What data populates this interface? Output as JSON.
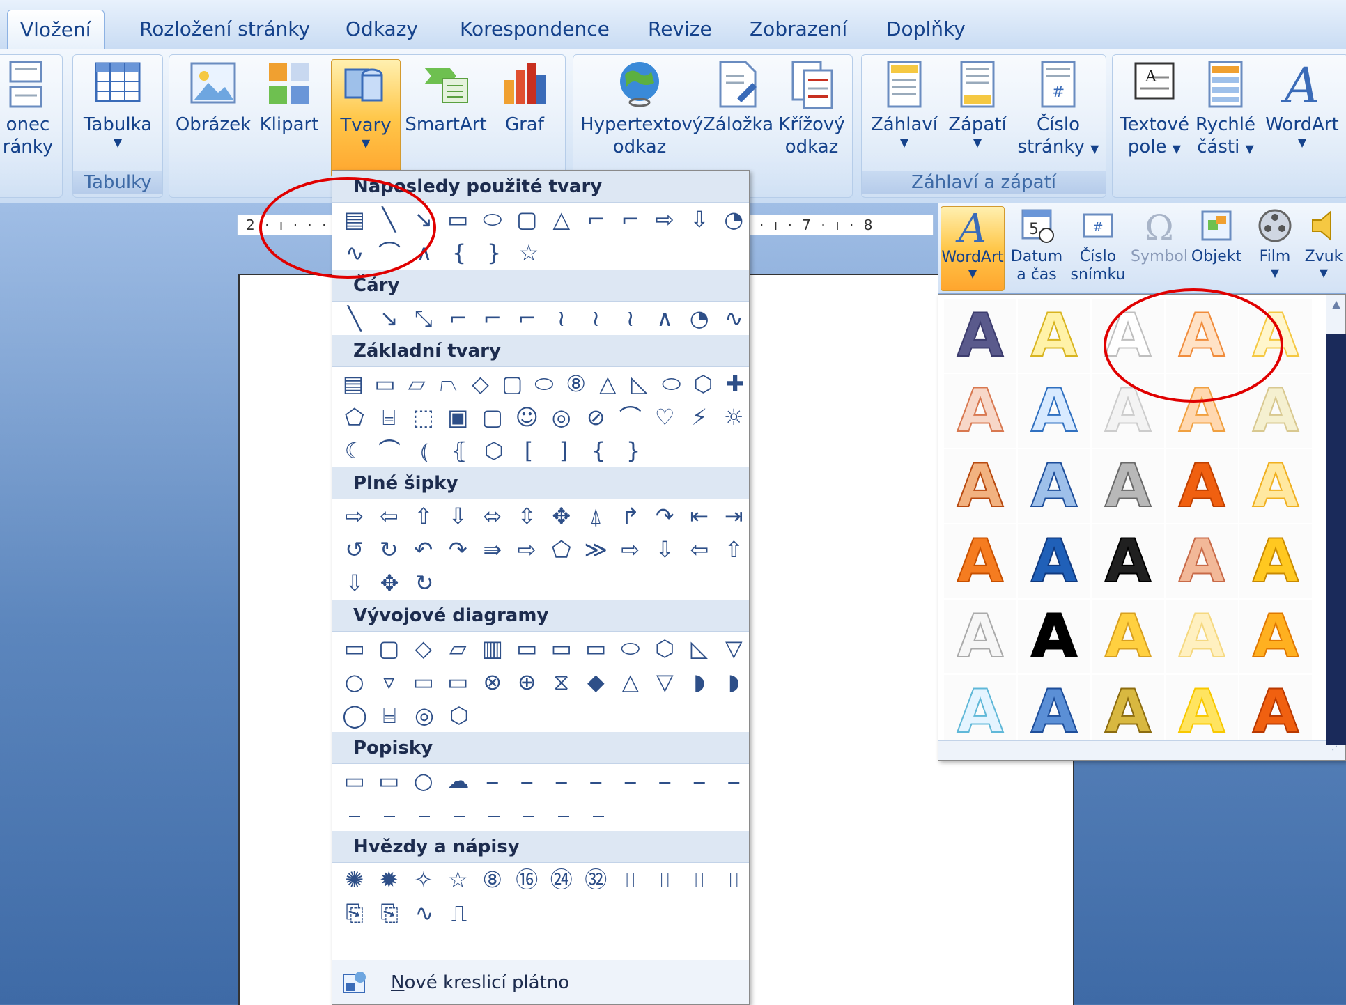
{
  "tabs": [
    {
      "label": "Vložení",
      "active": true
    },
    {
      "label": "Rozložení stránky"
    },
    {
      "label": "Odkazy"
    },
    {
      "label": "Korespondence"
    },
    {
      "label": "Revize"
    },
    {
      "label": "Zobrazení"
    },
    {
      "label": "Doplňky"
    }
  ],
  "ribbon": {
    "pagebreak": {
      "line1": "onec",
      "line2": "ránky"
    },
    "table": {
      "label": "Tabulka",
      "group": "Tabulky"
    },
    "illustrations": {
      "picture": "Obrázek",
      "clipart": "Klipart",
      "shapes": "Tvary",
      "smartart": "SmartArt",
      "chart": "Graf"
    },
    "links": {
      "hyperlink_line1": "Hypertextový",
      "hyperlink_line2": "odkaz",
      "bookmark": "Záložka",
      "crossref_line1": "Křížový",
      "crossref_line2": "odkaz"
    },
    "headerfooter": {
      "header": "Záhlaví",
      "footer": "Zápatí",
      "pagenum_line1": "Číslo",
      "pagenum_line2": "stránky",
      "group": "Záhlaví a zápatí"
    },
    "text": {
      "textbox_line1": "Textové",
      "textbox_line2": "pole",
      "quickparts_line1": "Rychlé",
      "quickparts_line2": "části",
      "wordart": "WordArt"
    }
  },
  "ruler": {
    "text": "2 · ı · · · · · · · · · · · · · · · · · · · · · · · · · · · · · · · 6 · ı · 7 · ı · 8"
  },
  "shapes_menu": {
    "sections": [
      {
        "title": "Naposledy použité tvary",
        "rows": [
          [
            "▤",
            "╲",
            "↘",
            "▭",
            "⬭",
            "▢",
            "△",
            "⌐",
            "⌐",
            "⇨",
            "⇩",
            "◔"
          ],
          [
            "∿",
            "⌒",
            "∧",
            "{",
            "}",
            "☆"
          ]
        ]
      },
      {
        "title": "Čáry",
        "rows": [
          [
            "╲",
            "↘",
            "⤡",
            "⌐",
            "⌐",
            "⌐",
            "≀",
            "≀",
            "≀",
            "∧",
            "◔",
            "∿"
          ]
        ]
      },
      {
        "title": "Základní tvary",
        "rows": [
          [
            "▤",
            "▭",
            "▱",
            "⏢",
            "◇",
            "▢",
            "⬭",
            "⑧",
            "△",
            "◺",
            "⬭",
            "⬡",
            "✚"
          ],
          [
            "⬠",
            "⌸",
            "⬚",
            "▣",
            "▢",
            "☺",
            "◎",
            "⊘",
            "⌒",
            "♡",
            "⚡",
            "☼"
          ],
          [
            "☾",
            "⌒",
            "⦅",
            "⦃",
            "⬡",
            "[",
            "]",
            "{",
            "}"
          ]
        ]
      },
      {
        "title": "Plné šipky",
        "rows": [
          [
            "⇨",
            "⇦",
            "⇧",
            "⇩",
            "⬄",
            "⇳",
            "✥",
            "⍋",
            "↱",
            "↷",
            "⇤",
            "⇥"
          ],
          [
            "↺",
            "↻",
            "↶",
            "↷",
            "⇛",
            "⇨",
            "⬠",
            "≫",
            "⇨",
            "⇩",
            "⇦",
            "⇧"
          ],
          [
            "⇩",
            "✥",
            "↻"
          ]
        ]
      },
      {
        "title": "Vývojové diagramy",
        "rows": [
          [
            "▭",
            "▢",
            "◇",
            "▱",
            "▥",
            "▭",
            "▭",
            "▭",
            "⬭",
            "⬡",
            "◺",
            "▽"
          ],
          [
            "○",
            "▿",
            "▭",
            "▭",
            "⊗",
            "⊕",
            "⧖",
            "◆",
            "△",
            "▽",
            "◗",
            "◗"
          ],
          [
            "◯",
            "⌸",
            "◎",
            "⬡"
          ]
        ]
      },
      {
        "title": "Popisky",
        "rows": [
          [
            "▭",
            "▭",
            "○",
            "☁",
            "⎯",
            "⎯",
            "⎯",
            "⎯",
            "⎯",
            "⎯",
            "⎯",
            "⎯"
          ],
          [
            "⎯",
            "⎯",
            "⎯",
            "⎯",
            "⎯",
            "⎯",
            "⎯",
            "⎯"
          ]
        ]
      },
      {
        "title": "Hvězdy a nápisy",
        "rows": [
          [
            "✺",
            "✹",
            "✧",
            "☆",
            "⑧",
            "⑯",
            "㉔",
            "㉜",
            "⎍",
            "⎍",
            "⎍",
            "⎍"
          ],
          [
            "⎘",
            "⎘",
            "∿",
            "⎍"
          ]
        ]
      }
    ],
    "new_canvas": "Nové kreslicí plátno"
  },
  "ppt_toolbar": {
    "wordart": "WordArt",
    "datetime_line1": "Datum",
    "datetime_line2": "a čas",
    "slidenum_line1": "Číslo",
    "slidenum_line2": "snímku",
    "symbol": "Symbol",
    "object": "Objekt",
    "movie": "Film",
    "sound": "Zvuk"
  },
  "wordart_gallery": {
    "letter": "A",
    "styles": [
      {
        "fill": "#5a5a8c",
        "stroke": "#3c3c6e"
      },
      {
        "fill": "#fff2a8",
        "stroke": "#d8b420"
      },
      {
        "fill": "#ffffff",
        "stroke": "#bfbfbf"
      },
      {
        "fill": "#ffe2c6",
        "stroke": "#f08c3c"
      },
      {
        "fill": "#fff6cc",
        "stroke": "#f5c842"
      },
      {
        "fill": "#f7d7c8",
        "stroke": "#d87850"
      },
      {
        "fill": "#d8eaff",
        "stroke": "#3070c0"
      },
      {
        "fill": "#f3f3f3",
        "stroke": "#cccccc"
      },
      {
        "fill": "#ffd8b0",
        "stroke": "#f0a040"
      },
      {
        "fill": "#f5f0d0",
        "stroke": "#d8c890"
      },
      {
        "fill": "#f2b280",
        "stroke": "#b84a10"
      },
      {
        "fill": "#9ec0ea",
        "stroke": "#1e4e9a"
      },
      {
        "fill": "#b8b8b8",
        "stroke": "#6a6a6a"
      },
      {
        "fill": "#f06010",
        "stroke": "#c04000"
      },
      {
        "fill": "#ffe8a0",
        "stroke": "#f0b020"
      },
      {
        "fill": "#f57c20",
        "stroke": "#c85000"
      },
      {
        "fill": "#2060b8",
        "stroke": "#103a80"
      },
      {
        "fill": "#202020",
        "stroke": "#000000"
      },
      {
        "fill": "#f2b898",
        "stroke": "#c86a48"
      },
      {
        "fill": "#ffc820",
        "stroke": "#c88a00"
      },
      {
        "fill": "#f6f6f6",
        "stroke": "#aaaaaa"
      },
      {
        "fill": "#000000",
        "stroke": "#000000"
      },
      {
        "fill": "#ffd040",
        "stroke": "#d8a020"
      },
      {
        "fill": "#fff0c0",
        "stroke": "#f5d880"
      },
      {
        "fill": "#ffb020",
        "stroke": "#e07800"
      },
      {
        "fill": "#e4f4ff",
        "stroke": "#60b8d8"
      },
      {
        "fill": "#5b8fd6",
        "stroke": "#1e4e9a"
      },
      {
        "fill": "#d8b840",
        "stroke": "#8c6c10"
      },
      {
        "fill": "#ffe460",
        "stroke": "#f8c800"
      },
      {
        "fill": "#f06010",
        "stroke": "#b83800"
      }
    ]
  }
}
